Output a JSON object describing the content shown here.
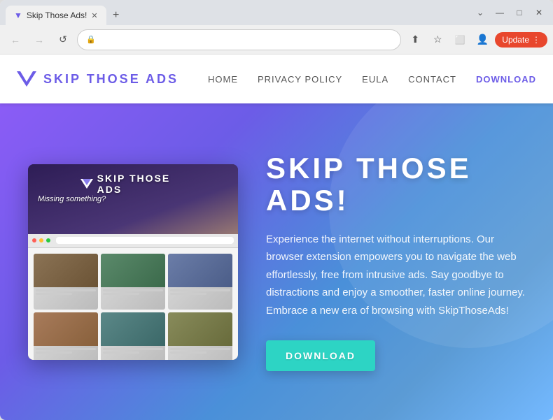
{
  "browser": {
    "tab_title": "Skip Those Ads!",
    "tab_favicon": "▼",
    "new_tab_icon": "+",
    "window_controls": {
      "minimize": "—",
      "maximize": "□",
      "close": "✕",
      "chevron": "⌄"
    },
    "nav": {
      "back": "←",
      "forward": "→",
      "refresh": "↺",
      "address": "",
      "lock": "🔒",
      "share_icon": "⬆",
      "star_icon": "☆",
      "profile_icon": "👤",
      "update_label": "Update",
      "more_icon": "⋮",
      "extensions_icon": "⬜"
    }
  },
  "site": {
    "logo_text": "SKIP THOSE ADS",
    "nav": {
      "home": "Home",
      "privacy": "Privacy Policy",
      "eula": "EULA",
      "contact": "Contact",
      "download": "DOWNLOAD"
    },
    "hero": {
      "image_logo_text": "SKIP THOSE ADS",
      "image_subtitle": "Missing something?",
      "title": "SKIP THOSE ADS!",
      "description": "Experience the internet without interruptions. Our browser extension empowers you to navigate the web effortlessly, free from intrusive ads. Say goodbye to distractions and enjoy a smoother, faster online journey. Embrace a new era of browsing with SkipThoseAds!",
      "download_btn": "DOWNLOAD"
    }
  }
}
